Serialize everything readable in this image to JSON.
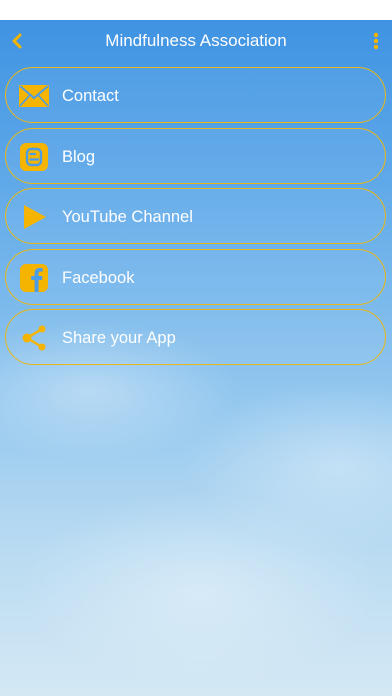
{
  "header": {
    "title": "Mindfulness Association"
  },
  "menu": {
    "items": [
      {
        "label": "Contact",
        "icon": "mail-icon"
      },
      {
        "label": "Blog",
        "icon": "blogger-icon"
      },
      {
        "label": "YouTube Channel",
        "icon": "play-icon"
      },
      {
        "label": "Facebook",
        "icon": "facebook-icon"
      },
      {
        "label": "Share your App",
        "icon": "share-icon"
      }
    ]
  },
  "colors": {
    "accent": "#f5b400",
    "border": "#e8b81a",
    "sky_top": "#3f93e2",
    "sky_bottom": "#d4e8f4"
  }
}
